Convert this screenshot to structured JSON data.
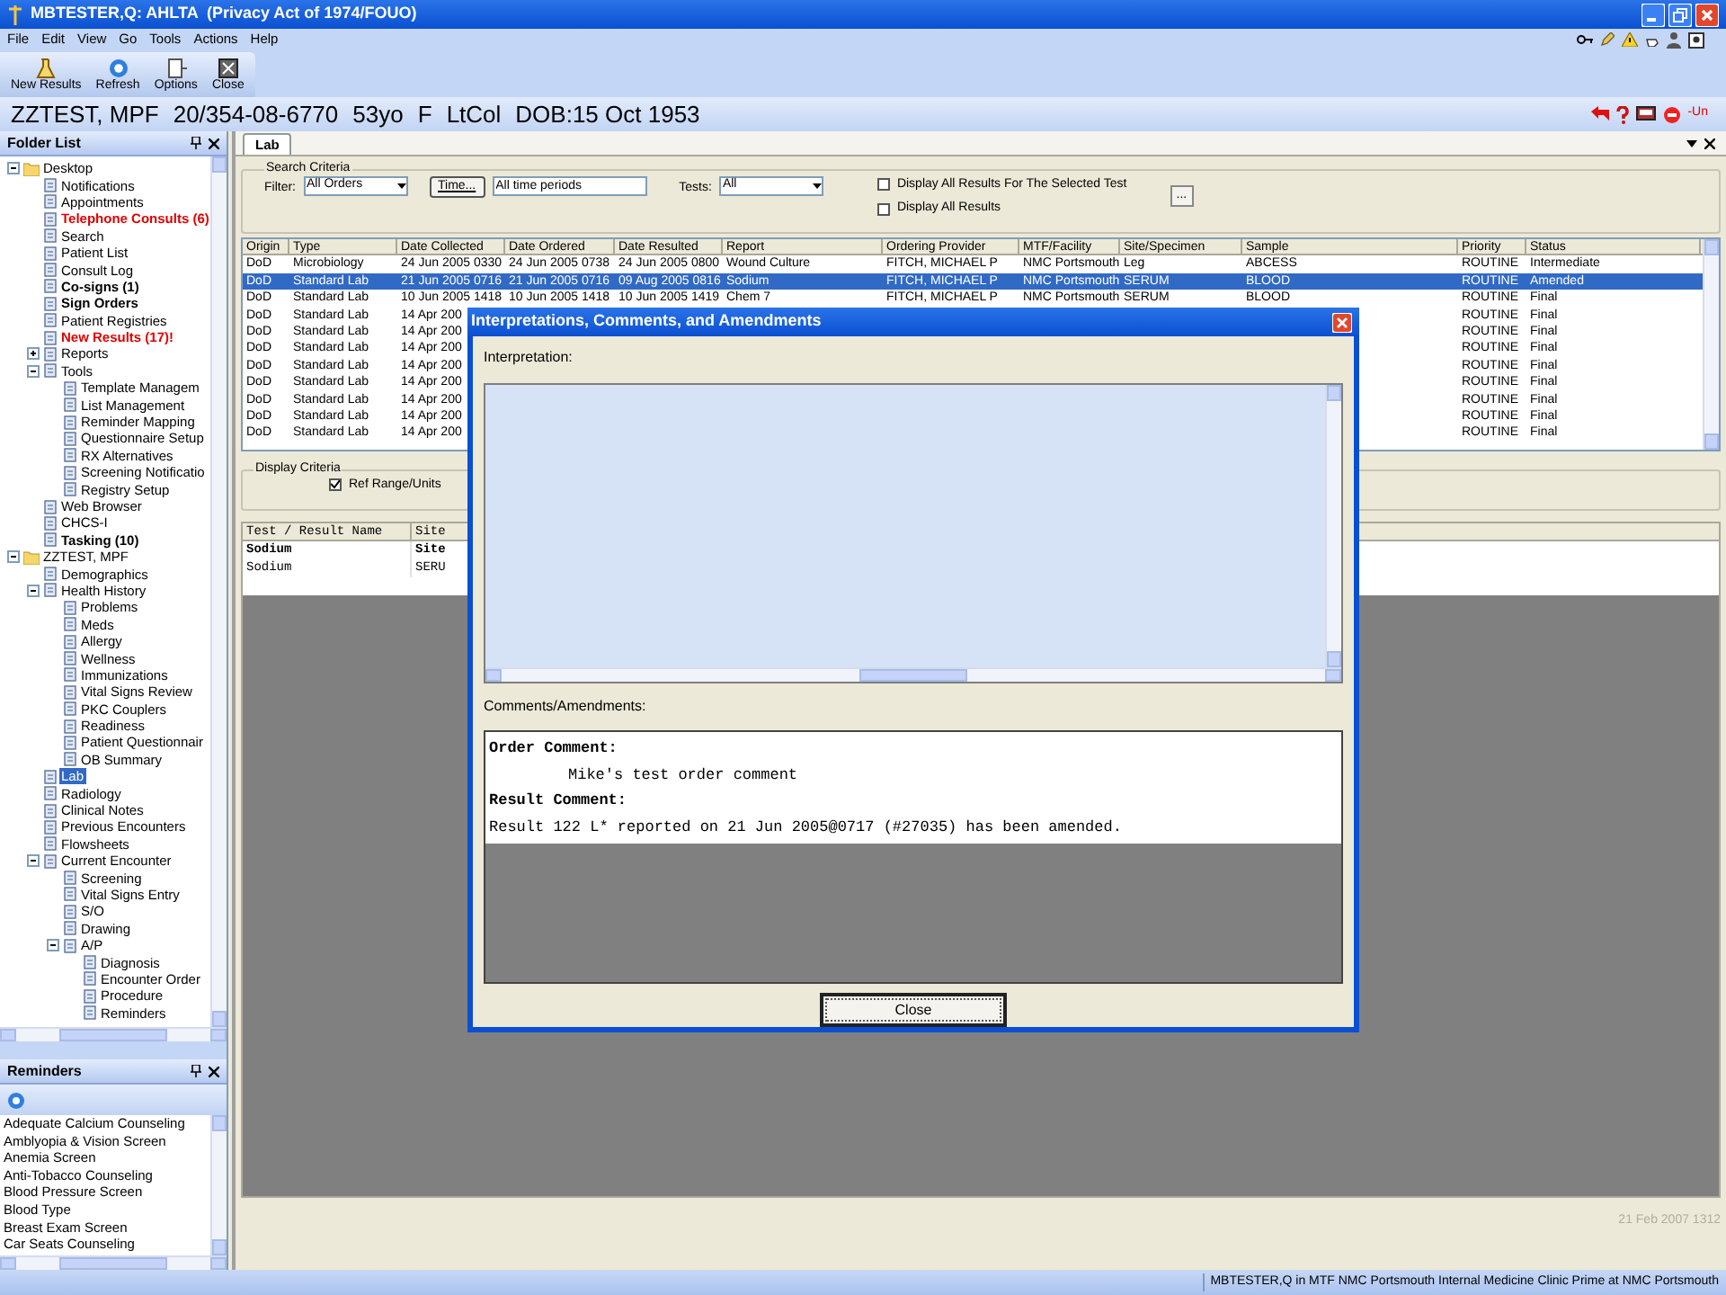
{
  "window": {
    "title": "MBTESTER,Q: AHLTA  (Privacy Act of 1974/FOUO)"
  },
  "menu": [
    "File",
    "Edit",
    "View",
    "Go",
    "Tools",
    "Actions",
    "Help"
  ],
  "toolbar": [
    {
      "label": "New Results",
      "kind": "results"
    },
    {
      "label": "Refresh",
      "kind": "refresh"
    },
    {
      "label": "Options",
      "kind": "options"
    },
    {
      "label": "Close",
      "kind": "close"
    }
  ],
  "patient_banner": {
    "name": "ZZTEST, MPF",
    "id": "20/354-08-6770",
    "age": "53yo",
    "sex": "F",
    "rank": "LtCol",
    "dob": "DOB:15 Oct 1953",
    "badge": "-Un"
  },
  "folder_list": {
    "title": "Folder List",
    "tree": [
      {
        "label": "Desktop",
        "kind": "normal",
        "selected": false,
        "expanded": true,
        "children": [
          {
            "label": "Notifications",
            "kind": "normal",
            "selected": false
          },
          {
            "label": "Appointments",
            "kind": "normal",
            "selected": false
          },
          {
            "label": "Telephone Consults (6)",
            "kind": "alert",
            "selected": false
          },
          {
            "label": "Search",
            "kind": "normal",
            "selected": false
          },
          {
            "label": "Patient List",
            "kind": "normal",
            "selected": false
          },
          {
            "label": "Consult Log",
            "kind": "normal",
            "selected": false
          },
          {
            "label": "Co-signs (1)",
            "kind": "bold",
            "selected": false
          },
          {
            "label": "Sign Orders",
            "kind": "bold",
            "selected": false
          },
          {
            "label": "Patient Registries",
            "kind": "normal",
            "selected": false
          },
          {
            "label": "New Results (17)!",
            "kind": "alert",
            "selected": false
          },
          {
            "label": "Reports",
            "kind": "normal",
            "selected": false,
            "expanded": false
          },
          {
            "label": "Tools",
            "kind": "normal",
            "selected": false,
            "expanded": true,
            "children": [
              {
                "label": "Template Managem",
                "kind": "normal",
                "selected": false
              },
              {
                "label": "List Management",
                "kind": "normal",
                "selected": false
              },
              {
                "label": "Reminder Mapping",
                "kind": "normal",
                "selected": false
              },
              {
                "label": "Questionnaire Setup",
                "kind": "normal",
                "selected": false
              },
              {
                "label": "RX Alternatives",
                "kind": "normal",
                "selected": false
              },
              {
                "label": "Screening Notificatio",
                "kind": "normal",
                "selected": false
              },
              {
                "label": "Registry Setup",
                "kind": "normal",
                "selected": false
              }
            ]
          },
          {
            "label": "Web Browser",
            "kind": "normal",
            "selected": false
          },
          {
            "label": "CHCS-I",
            "kind": "normal",
            "selected": false
          },
          {
            "label": "Tasking (10)",
            "kind": "bold",
            "selected": false
          }
        ]
      },
      {
        "label": "ZZTEST, MPF",
        "kind": "normal",
        "selected": false,
        "expanded": true,
        "children": [
          {
            "label": "Demographics",
            "kind": "normal",
            "selected": false
          },
          {
            "label": "Health History",
            "kind": "normal",
            "selected": false,
            "expanded": true,
            "children": [
              {
                "label": "Problems",
                "kind": "normal",
                "selected": false
              },
              {
                "label": "Meds",
                "kind": "normal",
                "selected": false
              },
              {
                "label": "Allergy",
                "kind": "normal",
                "selected": false
              },
              {
                "label": "Wellness",
                "kind": "normal",
                "selected": false
              },
              {
                "label": "Immunizations",
                "kind": "normal",
                "selected": false
              },
              {
                "label": "Vital Signs Review",
                "kind": "normal",
                "selected": false
              },
              {
                "label": "PKC Couplers",
                "kind": "normal",
                "selected": false
              },
              {
                "label": "Readiness",
                "kind": "normal",
                "selected": false
              },
              {
                "label": "Patient Questionnair",
                "kind": "normal",
                "selected": false
              },
              {
                "label": "OB Summary",
                "kind": "normal",
                "selected": false
              }
            ]
          },
          {
            "label": "Lab",
            "kind": "normal",
            "selected": true
          },
          {
            "label": "Radiology",
            "kind": "normal",
            "selected": false
          },
          {
            "label": "Clinical Notes",
            "kind": "normal",
            "selected": false
          },
          {
            "label": "Previous Encounters",
            "kind": "normal",
            "selected": false
          },
          {
            "label": "Flowsheets",
            "kind": "normal",
            "selected": false
          },
          {
            "label": "Current Encounter",
            "kind": "normal",
            "selected": false,
            "expanded": true,
            "children": [
              {
                "label": "Screening",
                "kind": "normal",
                "selected": false
              },
              {
                "label": "Vital Signs Entry",
                "kind": "normal",
                "selected": false
              },
              {
                "label": "S/O",
                "kind": "normal",
                "selected": false
              },
              {
                "label": "Drawing",
                "kind": "normal",
                "selected": false
              },
              {
                "label": "A/P",
                "kind": "normal",
                "selected": false,
                "expanded": true,
                "children": [
                  {
                    "label": "Diagnosis",
                    "kind": "normal",
                    "selected": false
                  },
                  {
                    "label": "Encounter Order",
                    "kind": "normal",
                    "selected": false
                  },
                  {
                    "label": "Procedure",
                    "kind": "normal",
                    "selected": false
                  },
                  {
                    "label": "Reminders",
                    "kind": "normal",
                    "selected": false
                  }
                ]
              }
            ]
          }
        ]
      }
    ]
  },
  "reminders": {
    "title": "Reminders",
    "items": [
      "Adequate Calcium Counseling",
      "Amblyopia & Vision Screen",
      "Anemia Screen",
      "Anti-Tobacco Counseling",
      "Blood Pressure Screen",
      "Blood Type",
      "Breast Exam Screen",
      "Car Seats Counseling"
    ]
  },
  "tabs": [
    {
      "label": "Lab",
      "selected": true
    }
  ],
  "search_criteria": {
    "title": "Search Criteria",
    "filter_label": "Filter:",
    "filter_value": "All Orders",
    "time_button": "Time...",
    "time_value": "All time periods",
    "tests_label": "Tests:",
    "tests_value": "All",
    "options": [
      {
        "label": "Display All Results For The Selected Test",
        "checked": false
      },
      {
        "label": "Display All Results",
        "checked": false
      }
    ],
    "more_button": "..."
  },
  "orders_table": {
    "columns": [
      "Origin",
      "Type",
      "Date Collected",
      "Date Ordered",
      "Date Resulted",
      "Report",
      "Ordering Provider",
      "MTF/Facility",
      "Site/Specimen",
      "Sample",
      "Priority",
      "Status"
    ],
    "rows": [
      {
        "selected": false,
        "origin": "DoD",
        "type": "Microbiology",
        "date_collected": "24 Jun 2005 0330",
        "date_ordered": "24 Jun 2005 0738",
        "date_resulted": "24 Jun 2005 0800",
        "report": "Wound Culture",
        "ordering_provider": "FITCH, MICHAEL P",
        "mtf_facility": "NMC Portsmouth",
        "site_specimen": "Leg",
        "sample": "ABCESS",
        "priority": "ROUTINE",
        "status": "Intermediate"
      },
      {
        "selected": true,
        "origin": "DoD",
        "type": "Standard Lab",
        "date_collected": "21 Jun 2005 0716",
        "date_ordered": "21 Jun 2005 0716",
        "date_resulted": "09 Aug 2005 0816",
        "report": "Sodium",
        "ordering_provider": "FITCH, MICHAEL P",
        "mtf_facility": "NMC Portsmouth",
        "site_specimen": "SERUM",
        "sample": "BLOOD",
        "priority": "ROUTINE",
        "status": "Amended"
      },
      {
        "selected": false,
        "origin": "DoD",
        "type": "Standard Lab",
        "date_collected": "10 Jun 2005 1418",
        "date_ordered": "10 Jun 2005 1418",
        "date_resulted": "10 Jun 2005 1419",
        "report": "Chem 7",
        "ordering_provider": "FITCH, MICHAEL P",
        "mtf_facility": "NMC Portsmouth",
        "site_specimen": "SERUM",
        "sample": "BLOOD",
        "priority": "ROUTINE",
        "status": "Final"
      },
      {
        "selected": false,
        "origin": "DoD",
        "type": "Standard Lab",
        "date_collected": "14 Apr 200",
        "priority": "ROUTINE",
        "status": "Final"
      },
      {
        "selected": false,
        "origin": "DoD",
        "type": "Standard Lab",
        "date_collected": "14 Apr 200",
        "priority": "ROUTINE",
        "status": "Final"
      },
      {
        "selected": false,
        "origin": "DoD",
        "type": "Standard Lab",
        "date_collected": "14 Apr 200",
        "priority": "ROUTINE",
        "status": "Final"
      },
      {
        "selected": false,
        "origin": "DoD",
        "type": "Standard Lab",
        "date_collected": "14 Apr 200",
        "priority": "ROUTINE",
        "status": "Final"
      },
      {
        "selected": false,
        "origin": "DoD",
        "type": "Standard Lab",
        "date_collected": "14 Apr 200",
        "priority": "ROUTINE",
        "status": "Final"
      },
      {
        "selected": false,
        "origin": "DoD",
        "type": "Standard Lab",
        "date_collected": "14 Apr 200",
        "priority": "ROUTINE",
        "status": "Final"
      },
      {
        "selected": false,
        "origin": "DoD",
        "type": "Standard Lab",
        "date_collected": "14 Apr 200",
        "priority": "ROUTINE",
        "status": "Final"
      },
      {
        "selected": false,
        "origin": "DoD",
        "type": "Standard Lab",
        "date_collected": "14 Apr 200",
        "priority": "ROUTINE",
        "status": "Final"
      }
    ]
  },
  "display_criteria": {
    "title": "Display Criteria",
    "options": [
      {
        "label": "Ref Range/Units",
        "checked": true
      }
    ]
  },
  "results_grid": {
    "columns": [
      "Test / Result Name",
      "Site"
    ],
    "rows": [
      {
        "bold": true,
        "cells": [
          "Sodium",
          "Site"
        ]
      },
      {
        "bold": false,
        "cells": [
          "Sodium",
          "SERU"
        ]
      }
    ]
  },
  "timestamp": "21 Feb 2007 1312",
  "status_bar": "MBTESTER,Q in MTF NMC Portsmouth Internal Medicine Clinic Prime at NMC Portsmouth",
  "dialog": {
    "title": "Interpretations, Comments, and Amendments",
    "interpretation_label": "Interpretation:",
    "comments_label": "Comments/Amendments:",
    "comments": [
      {
        "kind": "heading",
        "text": "Order Comment:"
      },
      {
        "kind": "indented",
        "text": "Mike's test order comment"
      },
      {
        "kind": "heading",
        "text": "Result Comment:"
      },
      {
        "kind": "text",
        "text": "Result 122 L* reported on 21 Jun 2005@0717 (#27035) has been amended."
      }
    ],
    "close_button": "Close"
  }
}
